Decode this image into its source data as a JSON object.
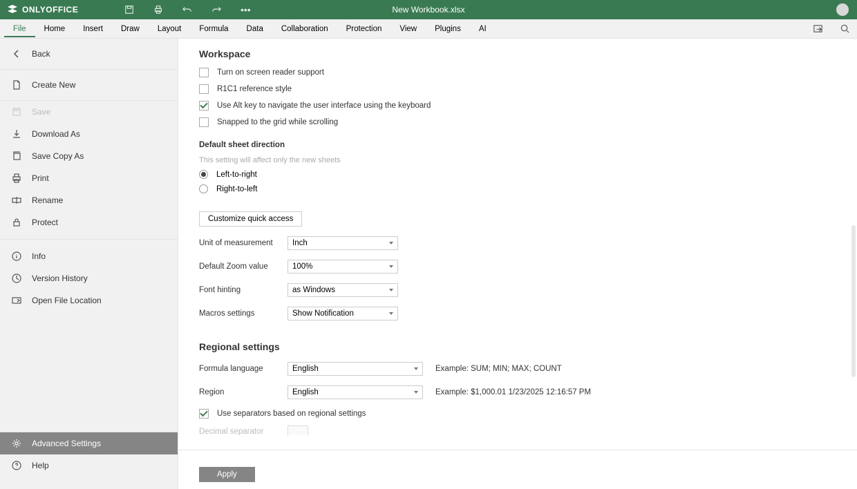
{
  "app": {
    "brand": "ONLYOFFICE",
    "docTitle": "New Workbook.xlsx"
  },
  "menuTabs": [
    "File",
    "Home",
    "Insert",
    "Draw",
    "Layout",
    "Formula",
    "Data",
    "Collaboration",
    "Protection",
    "View",
    "Plugins",
    "AI"
  ],
  "sidebar": {
    "back": "Back",
    "createNew": "Create New",
    "save": "Save",
    "downloadAs": "Download As",
    "saveCopyAs": "Save Copy As",
    "print": "Print",
    "rename": "Rename",
    "protect": "Protect",
    "info": "Info",
    "versionHistory": "Version History",
    "openFileLocation": "Open File Location",
    "advancedSettings": "Advanced Settings",
    "help": "Help"
  },
  "workspace": {
    "heading": "Workspace",
    "screenReader": "Turn on screen reader support",
    "r1c1": "R1C1 reference style",
    "altKey": "Use Alt key to navigate the user interface using the keyboard",
    "snapGrid": "Snapped to the grid while scrolling",
    "sheetDirHeading": "Default sheet direction",
    "sheetDirNote": "This setting will affect only the new sheets",
    "ltr": "Left-to-right",
    "rtl": "Right-to-left",
    "customizeQA": "Customize quick access",
    "unitLabel": "Unit of measurement",
    "unitValue": "Inch",
    "zoomLabel": "Default Zoom value",
    "zoomValue": "100%",
    "fontHintLabel": "Font hinting",
    "fontHintValue": "as Windows",
    "macrosLabel": "Macros settings",
    "macrosValue": "Show Notification"
  },
  "regional": {
    "heading": "Regional settings",
    "formulaLangLabel": "Formula language",
    "formulaLangValue": "English",
    "formulaExample": "Example: SUM; MIN; MAX; COUNT",
    "regionLabel": "Region",
    "regionValue": "English",
    "regionExample": "Example: $1,000.01 1/23/2025 12:16:57 PM",
    "useSeparators": "Use separators based on regional settings",
    "decimalSepLabel": "Decimal separator",
    "decimalSepValue": "."
  },
  "footer": {
    "apply": "Apply"
  }
}
